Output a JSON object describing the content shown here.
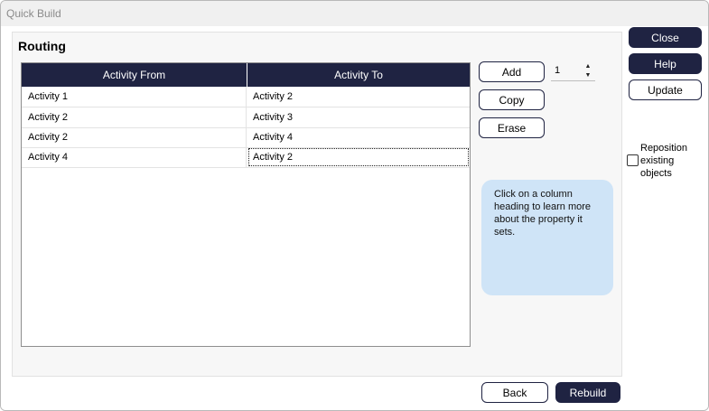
{
  "window": {
    "title": "Quick Build"
  },
  "section": {
    "title": "Routing"
  },
  "table": {
    "columns": [
      "Activity From",
      "Activity To"
    ],
    "rows": [
      [
        "Activity 1",
        "Activity 2"
      ],
      [
        "Activity 2",
        "Activity 3"
      ],
      [
        "Activity 2",
        "Activity 4"
      ],
      [
        "Activity 4",
        "Activity 2"
      ]
    ]
  },
  "actions": {
    "add": "Add",
    "copy": "Copy",
    "erase": "Erase"
  },
  "spinner": {
    "value": "1"
  },
  "info": {
    "text": "Click on a column heading to learn more about the property it sets."
  },
  "side": {
    "close": "Close",
    "help": "Help",
    "update": "Update",
    "reposition_label_1": "Reposition",
    "reposition_label_2": "existing",
    "reposition_label_3": "objects"
  },
  "footer": {
    "back": "Back",
    "rebuild": "Rebuild"
  },
  "colors": {
    "accent": "#1f2342",
    "info_bg": "#cfe4f7"
  }
}
